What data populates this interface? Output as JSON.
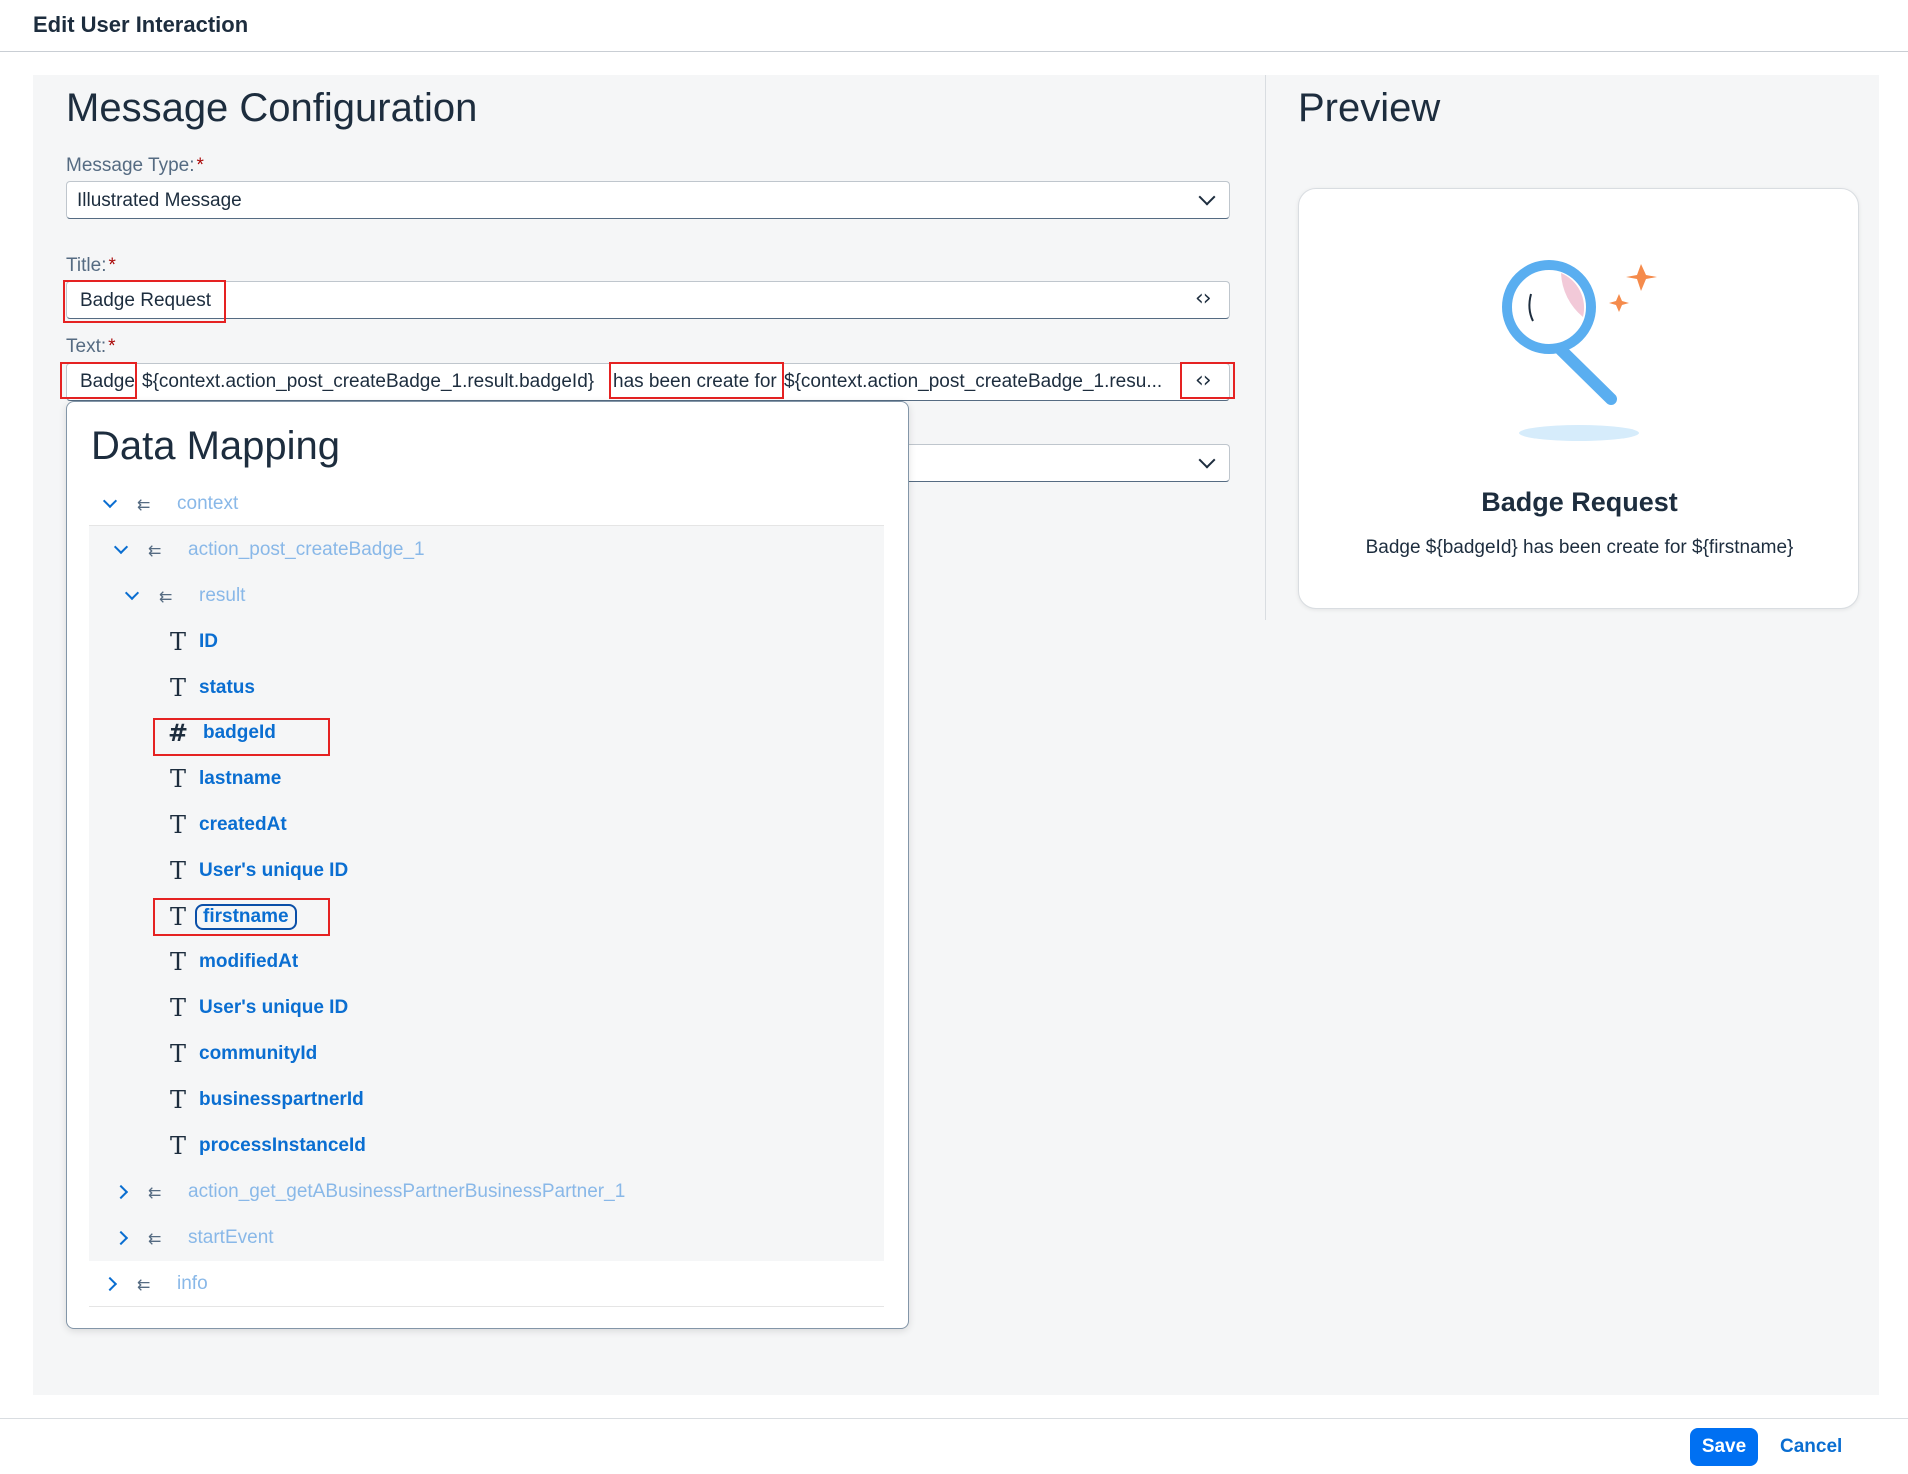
{
  "header": {
    "title": "Edit User Interaction"
  },
  "config": {
    "section_title": "Message Configuration",
    "message_type": {
      "label": "Message Type:",
      "required_mark": "*",
      "value": "Illustrated Message"
    },
    "title_field": {
      "label": "Title:",
      "required_mark": "*",
      "value": "Badge Request"
    },
    "text_field": {
      "label": "Text:",
      "required_mark": "*",
      "segments": [
        "Badge",
        "${context.action_post_createBadge_1.result.badgeId}",
        "has been create for",
        "${context.action_post_createBadge_1.resu..."
      ]
    }
  },
  "data_mapping": {
    "title": "Data Mapping",
    "tree": {
      "context": "context",
      "action_post": "action_post_createBadge_1",
      "result": "result",
      "leaves": [
        {
          "icon": "T",
          "label": "ID"
        },
        {
          "icon": "T",
          "label": "status"
        },
        {
          "icon": "#",
          "label": "badgeId"
        },
        {
          "icon": "T",
          "label": "lastname"
        },
        {
          "icon": "T",
          "label": "createdAt"
        },
        {
          "icon": "T",
          "label": "User's unique ID"
        },
        {
          "icon": "T",
          "label": "firstname"
        },
        {
          "icon": "T",
          "label": "modifiedAt"
        },
        {
          "icon": "T",
          "label": "User's unique ID"
        },
        {
          "icon": "T",
          "label": "communityId"
        },
        {
          "icon": "T",
          "label": "businesspartnerId"
        },
        {
          "icon": "T",
          "label": "processInstanceId"
        }
      ],
      "action_get": "action_get_getABusinessPartnerBusinessPartner_1",
      "start_event": "startEvent",
      "info": "info"
    }
  },
  "preview": {
    "section_title": "Preview",
    "title": "Badge Request",
    "text": "Badge ${badgeId} has been create for ${firstname}"
  },
  "footer": {
    "save_label": "Save",
    "cancel_label": "Cancel"
  },
  "colors": {
    "accent": "#0070f2",
    "highlight": "#e52222",
    "link": "#0a6ed1"
  }
}
